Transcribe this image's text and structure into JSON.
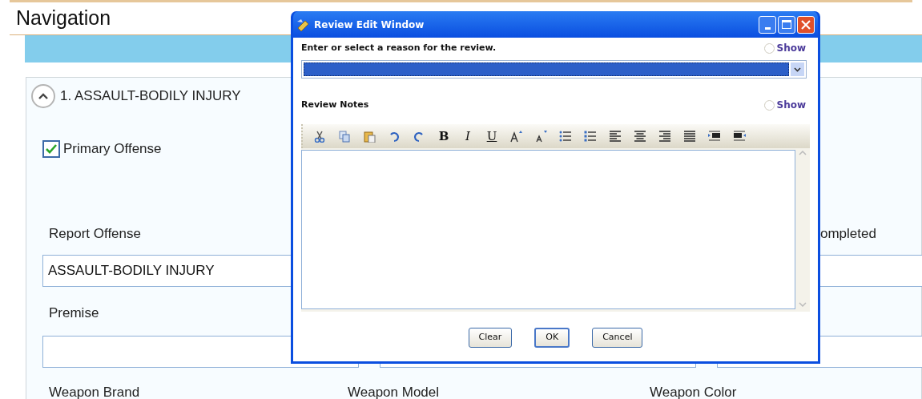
{
  "navigation": {
    "title": "Navigation"
  },
  "section": {
    "title": "1. ASSAULT-BODILY INJURY",
    "expanded": true
  },
  "primary_offense": {
    "label": "Primary Offense",
    "checked": true
  },
  "report_offense": {
    "label": "Report Offense",
    "value": "ASSAULT-BODILY INJURY"
  },
  "column_3_label": "ompleted",
  "premise": {
    "label": "Premise"
  },
  "bottom_labels": [
    "Weapon Brand",
    "Weapon Model",
    "Weapon Color"
  ],
  "dialog": {
    "title": "Review Edit Window",
    "reason_label": "Enter or select a reason for the review.",
    "reason_show": {
      "label": "Show",
      "selected": false
    },
    "notes_label": "Review Notes",
    "notes_show": {
      "label": "Show",
      "selected": false
    },
    "toolbar": [
      {
        "kind": "cut"
      },
      {
        "kind": "copy"
      },
      {
        "kind": "paste"
      },
      {
        "kind": "undo"
      },
      {
        "kind": "redo"
      },
      {
        "kind": "bold",
        "glyph": "B"
      },
      {
        "kind": "italic",
        "glyph": "I"
      },
      {
        "kind": "underline",
        "glyph": "U"
      },
      {
        "kind": "grow"
      },
      {
        "kind": "shrink"
      },
      {
        "kind": "bullets"
      },
      {
        "kind": "numbers"
      },
      {
        "kind": "align-left"
      },
      {
        "kind": "align-center"
      },
      {
        "kind": "align-right"
      },
      {
        "kind": "justify"
      },
      {
        "kind": "indent"
      },
      {
        "kind": "outdent"
      }
    ],
    "buttons": [
      {
        "label": "Clear",
        "default": false
      },
      {
        "label": "OK",
        "default": true
      },
      {
        "label": "Cancel",
        "default": false
      }
    ]
  }
}
